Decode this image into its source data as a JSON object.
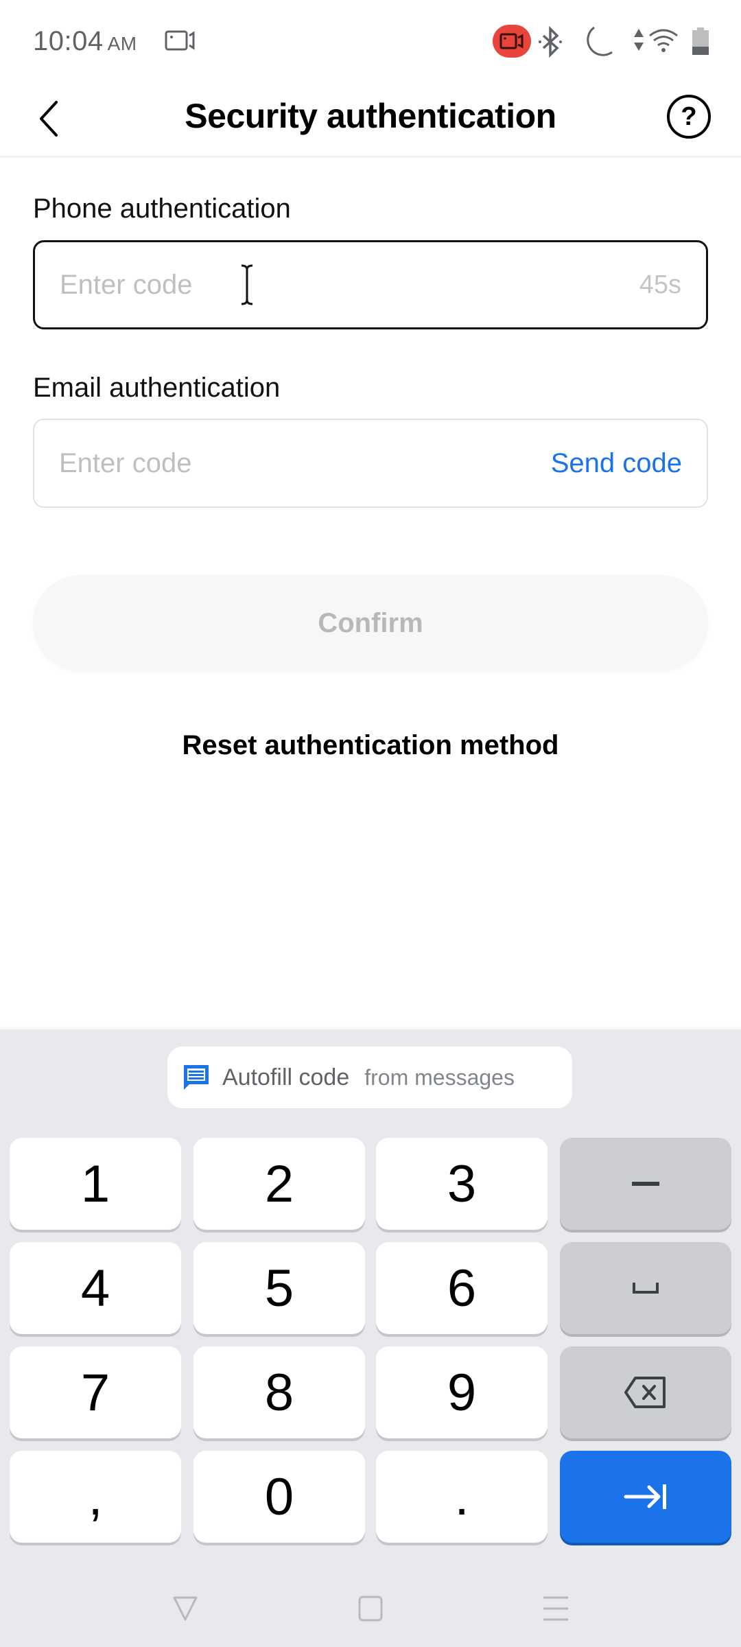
{
  "status_bar": {
    "time": "10:04",
    "ampm": "AM",
    "icons": [
      "screen-record-icon",
      "recording-indicator-icon",
      "bluetooth-icon",
      "do-not-disturb-moon-icon",
      "data-arrows-icon",
      "wifi-icon",
      "battery-icon"
    ]
  },
  "header": {
    "title": "Security authentication",
    "back_icon": "chevron-left-icon",
    "help_label": "?"
  },
  "phone_auth": {
    "label": "Phone authentication",
    "input_value": "",
    "placeholder": "Enter code",
    "countdown": "45s"
  },
  "email_auth": {
    "label": "Email authentication",
    "input_value": "",
    "placeholder": "Enter code",
    "send_code_label": "Send code"
  },
  "actions": {
    "confirm_label": "Confirm",
    "reset_label": "Reset authentication method"
  },
  "keyboard": {
    "autofill": {
      "icon": "message-icon",
      "main": "Autofill code",
      "sub": "from messages"
    },
    "keys": [
      {
        "label": "1"
      },
      {
        "label": "2"
      },
      {
        "label": "3"
      },
      {
        "label": "–",
        "name": "dash"
      },
      {
        "label": "4"
      },
      {
        "label": "5"
      },
      {
        "label": "6"
      },
      {
        "label": "space",
        "name": "space"
      },
      {
        "label": "7"
      },
      {
        "label": "8"
      },
      {
        "label": "9"
      },
      {
        "label": "backspace",
        "name": "backspace"
      },
      {
        "label": ","
      },
      {
        "label": "0"
      },
      {
        "label": "."
      },
      {
        "label": "next",
        "name": "next"
      }
    ]
  },
  "nav_bar": {
    "buttons": [
      "back",
      "home",
      "recents"
    ]
  },
  "colors": {
    "accent": "#1a73e8",
    "keyboard_bg": "#e8e9ec",
    "recording": "#e8453c",
    "placeholder": "#bfbfbf"
  }
}
